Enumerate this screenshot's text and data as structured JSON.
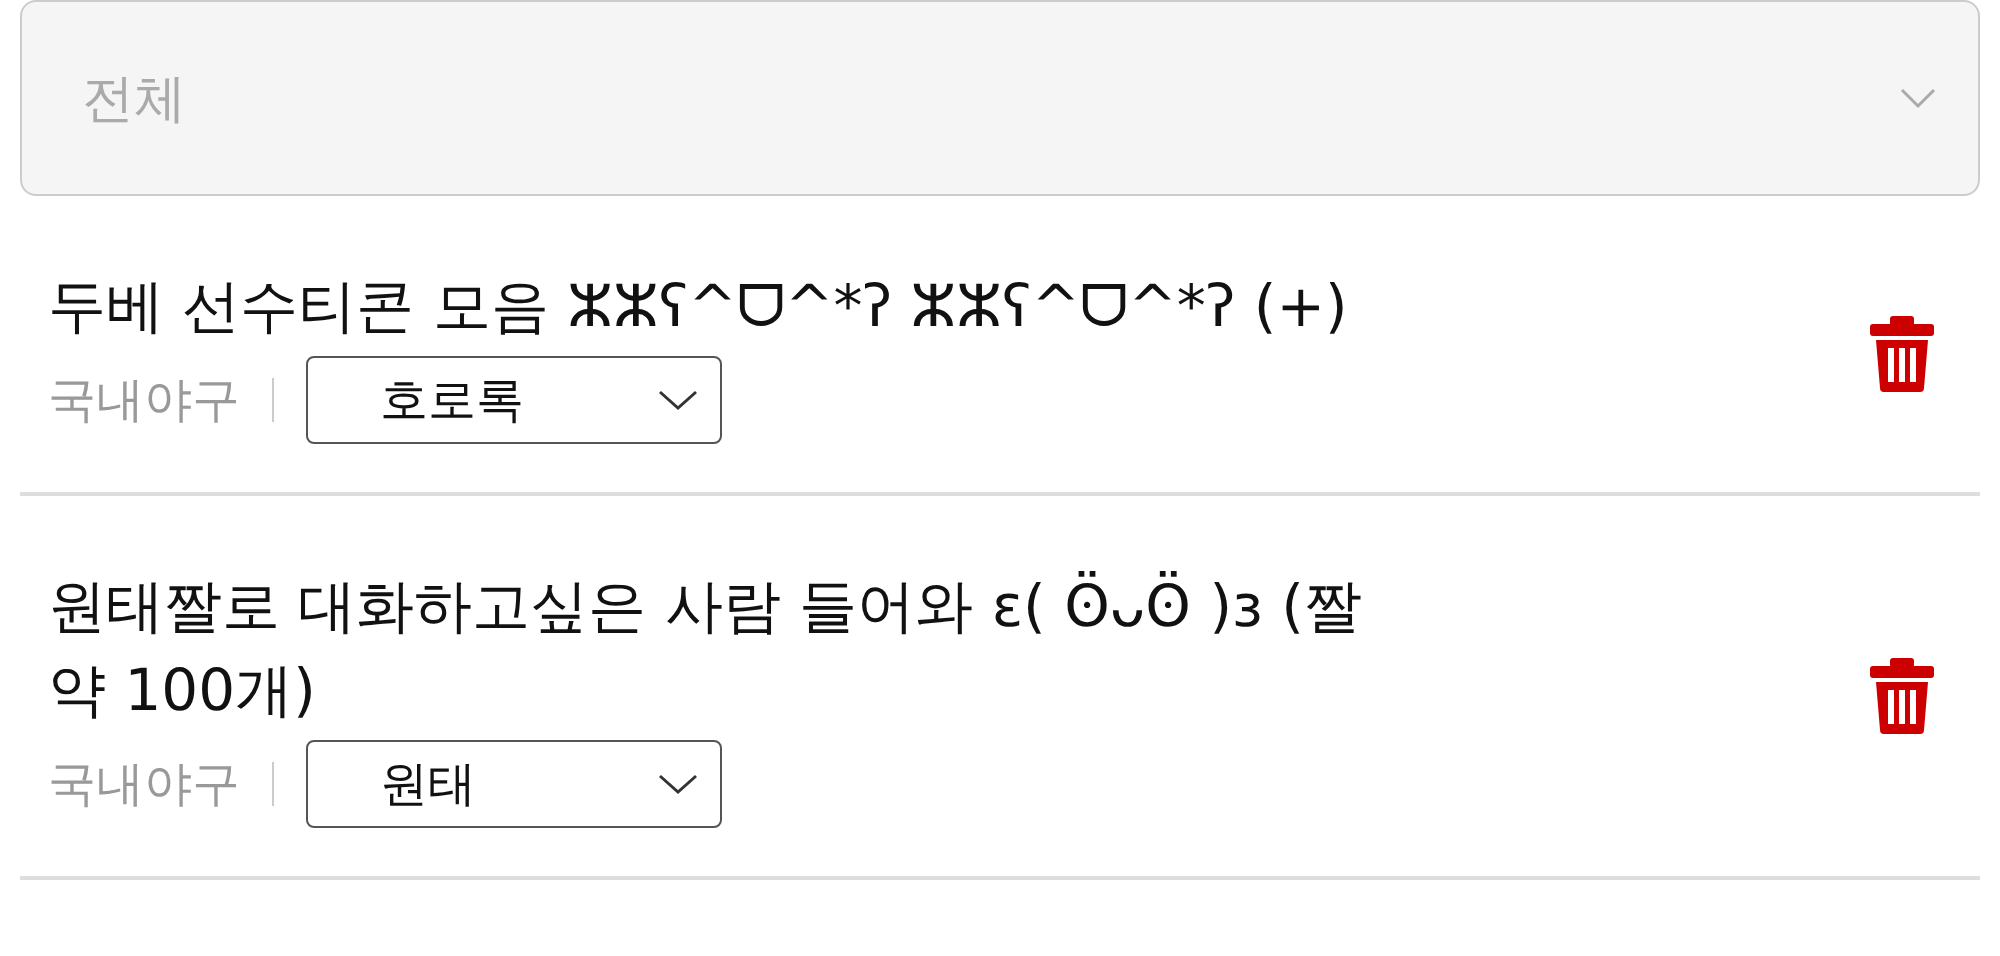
{
  "filter": {
    "placeholder": "전체"
  },
  "posts": [
    {
      "title": "두베 선수티콘 모음 ⵣⵣʕ^ᗜ^*ʔ ⵣⵣʕ^ᗜ^*ʔ (+)",
      "category": "국내야구",
      "team": "호로록"
    },
    {
      "title": "원태짤로 대화하고싶은 사람 들어와 ε( ʘ̈ᴗʘ̈ )з (짤 약 100개)",
      "category": "국내야구",
      "team": "원태"
    }
  ]
}
